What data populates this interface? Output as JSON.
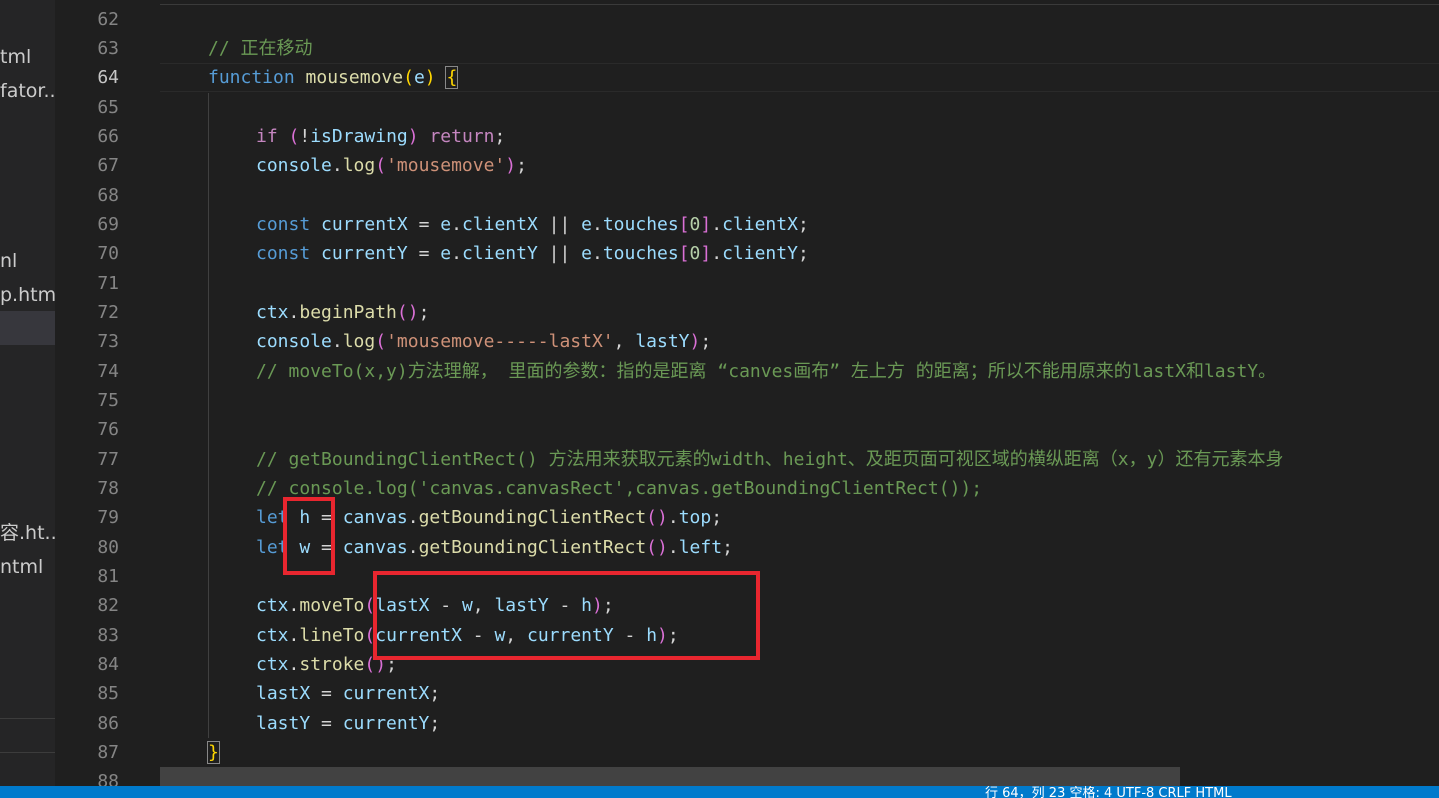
{
  "sidebar": {
    "items": [
      "tml",
      "fator...",
      "nl",
      "p.html",
      "容.ht...",
      "ntml"
    ]
  },
  "gutter": {
    "lines": [
      "62",
      "63",
      "64",
      "65",
      "66",
      "67",
      "68",
      "69",
      "70",
      "71",
      "72",
      "73",
      "74",
      "75",
      "76",
      "77",
      "78",
      "79",
      "80",
      "81",
      "82",
      "83",
      "84",
      "85",
      "86",
      "87",
      "88"
    ],
    "active_line": "64"
  },
  "code": {
    "l63": "// 正在移动",
    "l64_kw": "function",
    "l64_fn": "mousemove",
    "l64_param": "e",
    "l66_if": "if",
    "l66_var": "isDrawing",
    "l66_ret": "return",
    "l67_obj": "console",
    "l67_fn": "log",
    "l67_str": "'mousemove'",
    "l69_const": "const",
    "l69_var": "currentX",
    "l69_e": "e",
    "l69_prop": "clientX",
    "l69_touches": "touches",
    "l69_idx": "0",
    "l70_const": "const",
    "l70_var": "currentY",
    "l70_e": "e",
    "l70_prop": "clientY",
    "l70_touches": "touches",
    "l70_idx": "0",
    "l72_obj": "ctx",
    "l72_fn": "beginPath",
    "l73_obj": "console",
    "l73_fn": "log",
    "l73_str": "'mousemove-----lastX'",
    "l73_var": "lastY",
    "l74": "// moveTo(x,y)方法理解， 里面的参数：指的是距离 “canves画布” 左上方 的距离；所以不能用原来的lastX和lastY。",
    "l77": "// getBoundingClientRect() 方法用来获取元素的width、height、及距页面可视区域的横纵距离（x，y）还有元素本身",
    "l78": "// console.log('canvas.canvasRect',canvas.getBoundingClientRect());",
    "l79_let": "let",
    "l79_var": "h",
    "l79_obj": "canvas",
    "l79_fn": "getBoundingClientRect",
    "l79_prop": "top",
    "l80_let": "let",
    "l80_var": "w",
    "l80_obj": "canvas",
    "l80_fn": "getBoundingClientRect",
    "l80_prop": "left",
    "l82_obj": "ctx",
    "l82_fn": "moveTo",
    "l82_a": "lastX",
    "l82_b": "w",
    "l82_c": "lastY",
    "l82_d": "h",
    "l83_obj": "ctx",
    "l83_fn": "lineTo",
    "l83_a": "currentX",
    "l83_b": "w",
    "l83_c": "currentY",
    "l83_d": "h",
    "l84_obj": "ctx",
    "l84_fn": "stroke",
    "l85_a": "lastX",
    "l85_b": "currentX",
    "l86_a": "lastY",
    "l86_b": "currentY"
  },
  "colors": {
    "highlight_box": "#e8262f",
    "keyword": "#569cd6",
    "comment": "#6a9955",
    "string": "#ce9178",
    "function": "#dcdcaa",
    "variable": "#9cdcfe",
    "statusbar": "#007acc"
  },
  "statusbar": {
    "text": "行 64，列 23   空格: 4   UTF-8   CRLF   HTML"
  }
}
